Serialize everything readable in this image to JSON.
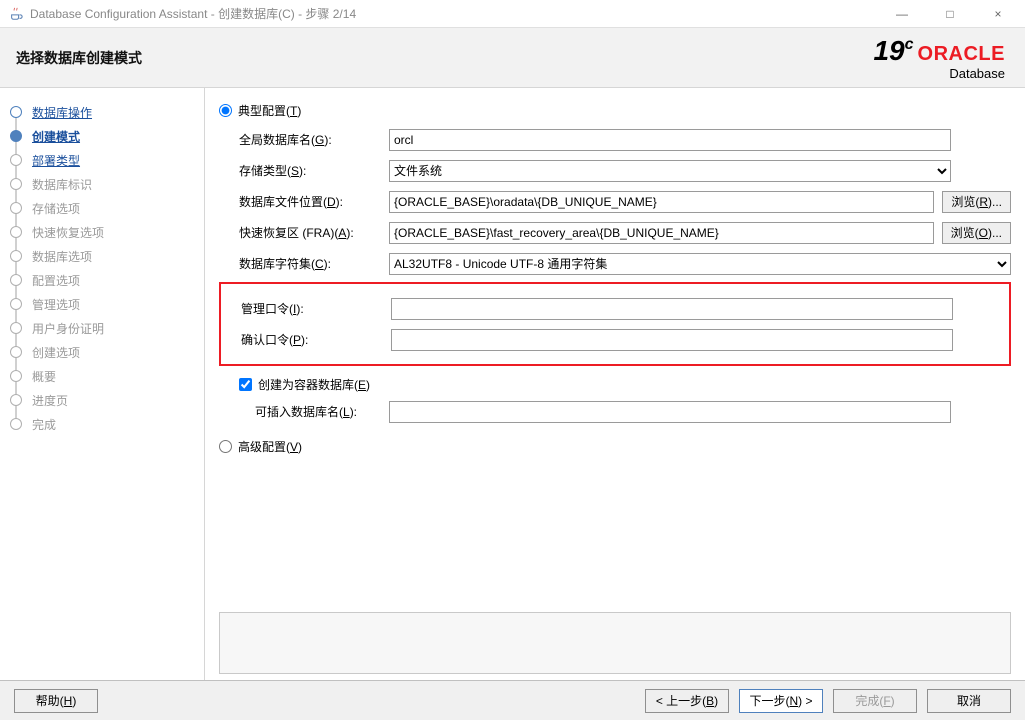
{
  "window": {
    "title": "Database Configuration Assistant - 创建数据库(C) - 步骤 2/14",
    "minimize": "—",
    "maximize": "□",
    "close": "×"
  },
  "header": {
    "page_title": "选择数据库创建模式",
    "brand_version": "19",
    "brand_version_sup": "c",
    "brand_name": "ORACLE",
    "brand_sub": "Database"
  },
  "sidebar": {
    "steps": [
      {
        "label": "数据库操作",
        "state": "done"
      },
      {
        "label": "创建模式",
        "state": "active"
      },
      {
        "label": "部署类型",
        "state": "enabled"
      },
      {
        "label": "数据库标识",
        "state": "disabled"
      },
      {
        "label": "存储选项",
        "state": "disabled"
      },
      {
        "label": "快速恢复选项",
        "state": "disabled"
      },
      {
        "label": "数据库选项",
        "state": "disabled"
      },
      {
        "label": "配置选项",
        "state": "disabled"
      },
      {
        "label": "管理选项",
        "state": "disabled"
      },
      {
        "label": "用户身份证明",
        "state": "disabled"
      },
      {
        "label": "创建选项",
        "state": "disabled"
      },
      {
        "label": "概要",
        "state": "disabled"
      },
      {
        "label": "进度页",
        "state": "disabled"
      },
      {
        "label": "完成",
        "state": "disabled"
      }
    ]
  },
  "form": {
    "radio_typical_pre": "典型配置(",
    "radio_typical_accel": "T",
    "radio_typical_post": ")",
    "radio_advanced_pre": "高级配置(",
    "radio_advanced_accel": "V",
    "radio_advanced_post": ")",
    "global_db_label_pre": "全局数据库名(",
    "global_db_label_accel": "G",
    "global_db_label_post": "):",
    "global_db_value": "orcl",
    "storage_label_pre": "存储类型(",
    "storage_label_accel": "S",
    "storage_label_post": "):",
    "storage_value": "文件系统",
    "dbfile_label_pre": "数据库文件位置(",
    "dbfile_label_accel": "D",
    "dbfile_label_post": "):",
    "dbfile_value": "{ORACLE_BASE}\\oradata\\{DB_UNIQUE_NAME}",
    "browse_r_pre": "浏览(",
    "browse_r_accel": "R",
    "browse_r_post": ")...",
    "fra_label_pre": "快速恢复区 (FRA)(",
    "fra_label_accel": "A",
    "fra_label_post": "):",
    "fra_value": "{ORACLE_BASE}\\fast_recovery_area\\{DB_UNIQUE_NAME}",
    "browse_o_pre": "浏览(",
    "browse_o_accel": "O",
    "browse_o_post": ")...",
    "charset_label_pre": "数据库字符集(",
    "charset_label_accel": "C",
    "charset_label_post": "):",
    "charset_value": "AL32UTF8 - Unicode UTF-8 通用字符集",
    "admin_pw_label_pre": "管理口令(",
    "admin_pw_label_accel": "I",
    "admin_pw_label_post": "):",
    "confirm_pw_label_pre": "确认口令(",
    "confirm_pw_label_accel": "P",
    "confirm_pw_label_post": "):",
    "container_label_pre": "创建为容器数据库(",
    "container_label_accel": "E",
    "container_label_post": ")",
    "pluggable_label_pre": "可插入数据库名(",
    "pluggable_label_accel": "L",
    "pluggable_label_post": "):"
  },
  "footer": {
    "help_pre": "帮助(",
    "help_accel": "H",
    "help_post": ")",
    "back_pre": "< 上一步(",
    "back_accel": "B",
    "back_post": ")",
    "next_pre": "下一步(",
    "next_accel": "N",
    "next_post": ") >",
    "finish_pre": "完成(",
    "finish_accel": "F",
    "finish_post": ")",
    "cancel": "取消"
  }
}
